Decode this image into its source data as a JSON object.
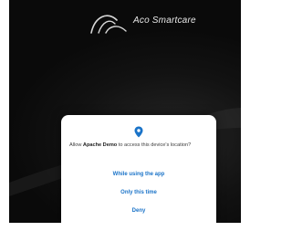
{
  "brand": {
    "name": "Aco Smartcare",
    "logo_icon": "aco-curve-logo"
  },
  "colors": {
    "background": "#121212",
    "dialog": "#ffffff",
    "accent": "#1a73c8"
  },
  "permission_dialog": {
    "icon": "location-pin-icon",
    "prompt_prefix": "Allow ",
    "app_name": "Apache Demo",
    "prompt_suffix": " to access this device's location?",
    "options": {
      "while_using": "While using the app",
      "only_this_time": "Only this time",
      "deny": "Deny"
    }
  }
}
